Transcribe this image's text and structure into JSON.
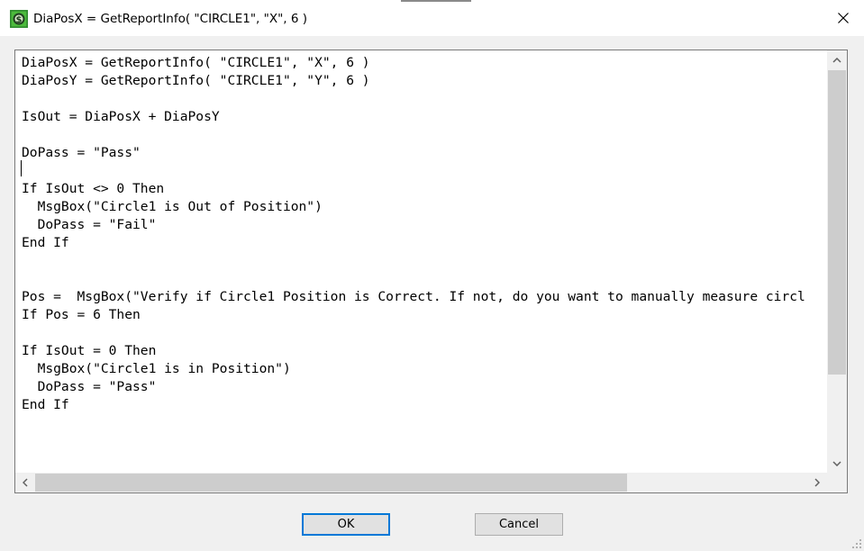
{
  "window": {
    "title": "DiaPosX = GetReportInfo( \"CIRCLE1\", \"X\", 6 )",
    "app_icon": "script-app-icon",
    "close_icon": "close-icon"
  },
  "editor": {
    "lines": [
      "DiaPosX = GetReportInfo( \"CIRCLE1\", \"X\", 6 )",
      "DiaPosY = GetReportInfo( \"CIRCLE1\", \"Y\", 6 )",
      "",
      "IsOut = DiaPosX + DiaPosY",
      "",
      "DoPass = \"Pass\"",
      "",
      "If IsOut <> 0 Then",
      "  MsgBox(\"Circle1 is Out of Position\")",
      "  DoPass = \"Fail\"",
      "End If",
      "",
      "",
      "Pos =  MsgBox(\"Verify if Circle1 Position is Correct. If not, do you want to manually measure circl",
      "If Pos = 6 Then",
      "",
      "If IsOut = 0 Then",
      "  MsgBox(\"Circle1 is in Position\")",
      "  DoPass = \"Pass\"",
      "End If"
    ]
  },
  "buttons": {
    "ok_label": "OK",
    "cancel_label": "Cancel"
  },
  "colors": {
    "title_bg": "#ffffff",
    "dialog_bg": "#f0f0f0",
    "default_button_border": "#0078d7",
    "scroll_thumb": "#cdcdcd"
  }
}
